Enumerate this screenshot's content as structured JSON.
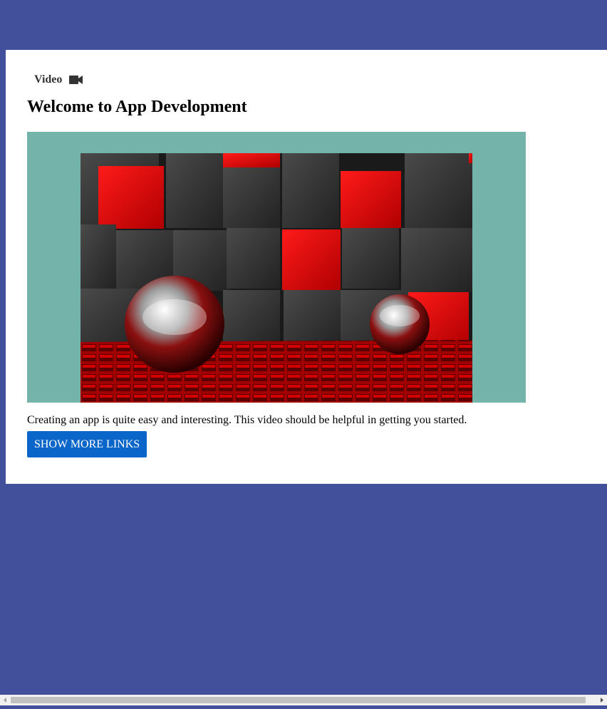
{
  "card": {
    "label": "Video",
    "label_icon": "video-camera-icon",
    "title": "Welcome to App Development",
    "media": {
      "frame_color": "#74b3a9",
      "image_description_icon": "video-thumbnail"
    },
    "description": "Creating an app is quite easy and interesting. This video should be helpful in getting you started.",
    "button_label": "SHOW MORE LINKS"
  },
  "colors": {
    "page_background": "#42509c",
    "card_background": "#ffffff",
    "button": "#0a66c8",
    "button_text": "#ffffff"
  },
  "scrollbar": {
    "orientation": "horizontal",
    "left_icon": "arrow-left-icon",
    "right_icon": "arrow-right-icon"
  }
}
